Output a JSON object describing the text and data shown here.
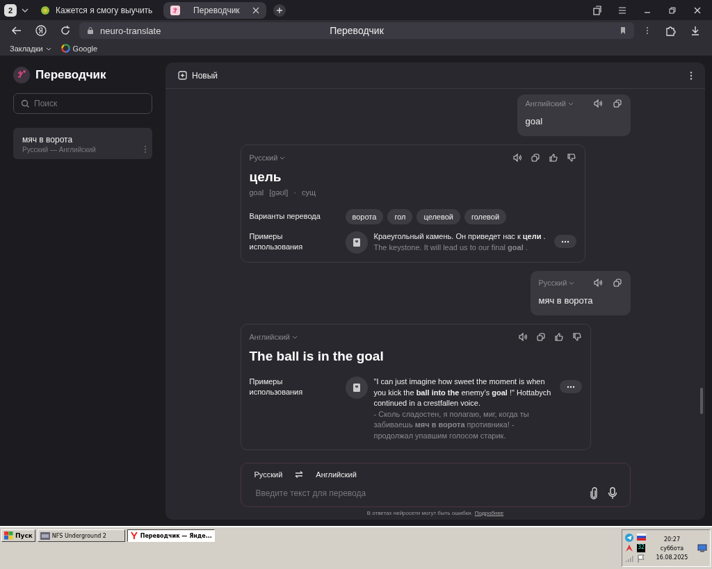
{
  "browser": {
    "tab_count": "2",
    "tabs": [
      {
        "title": "Кажется я смогу выучить",
        "selected": false
      },
      {
        "title": "Переводчик",
        "selected": true
      }
    ],
    "address": "neuro-translate",
    "page_title": "Переводчик",
    "bookmarks": [
      {
        "label": "Закладки",
        "kind": "folder"
      },
      {
        "label": "Google",
        "kind": "site"
      }
    ]
  },
  "sidebar": {
    "title": "Переводчик",
    "search": {
      "placeholder": "Поиск"
    },
    "history": [
      {
        "title": "мяч в ворота",
        "subtitle": "Русский — Английский",
        "selected": true
      }
    ]
  },
  "toolbar": {
    "new_button": "Новый"
  },
  "messages": [
    {
      "kind": "query",
      "language": "Английский",
      "text": "goal"
    },
    {
      "kind": "dictionary",
      "language": "Русский",
      "word": "цель",
      "meta": [
        "goal",
        "[gəʊl]",
        "·",
        "сущ"
      ],
      "variants_label": "Варианты перевода",
      "variants": [
        "ворота",
        "гол",
        "целевой",
        "голевой"
      ],
      "examples_label": "Примеры использования",
      "examples": [
        {
          "source": "Краеугольный камень. Он приведет нас к **цели** .",
          "translation": "The keystone. It will lead us to our final **goal** ."
        }
      ]
    },
    {
      "kind": "query",
      "language": "Русский",
      "text": "мяч в ворота"
    },
    {
      "kind": "phrase",
      "language": "Английский",
      "text": "The ball is in the goal",
      "examples_label": "Примеры использования",
      "examples": [
        {
          "source": "\"I can just imagine how sweet the moment is when you kick the **ball into the** enemy’s **goal** !\" Hottabych continued in a crestfallen voice.",
          "translation": "- Сколь сладостен, я полагаю, миг, когда ты забиваешь **мяч в ворота** противника! - продолжал упавшим голосом старик."
        }
      ]
    }
  ],
  "composer": {
    "from": "Русский",
    "to": "Английский",
    "placeholder": "Введите текст для перевода"
  },
  "disclaimer": {
    "text": "В ответах нейросети могут быть ошибки.",
    "link": "Подробнее"
  },
  "taskbar": {
    "start": "Пуск",
    "tasks": [
      {
        "title": "NFS Underground 2",
        "selected": false
      },
      {
        "title": "Переводчик — Янде...",
        "selected": true
      }
    ],
    "tray_badge": "32",
    "time": "20:27",
    "day": "суббота",
    "date": "16.08.2025"
  }
}
